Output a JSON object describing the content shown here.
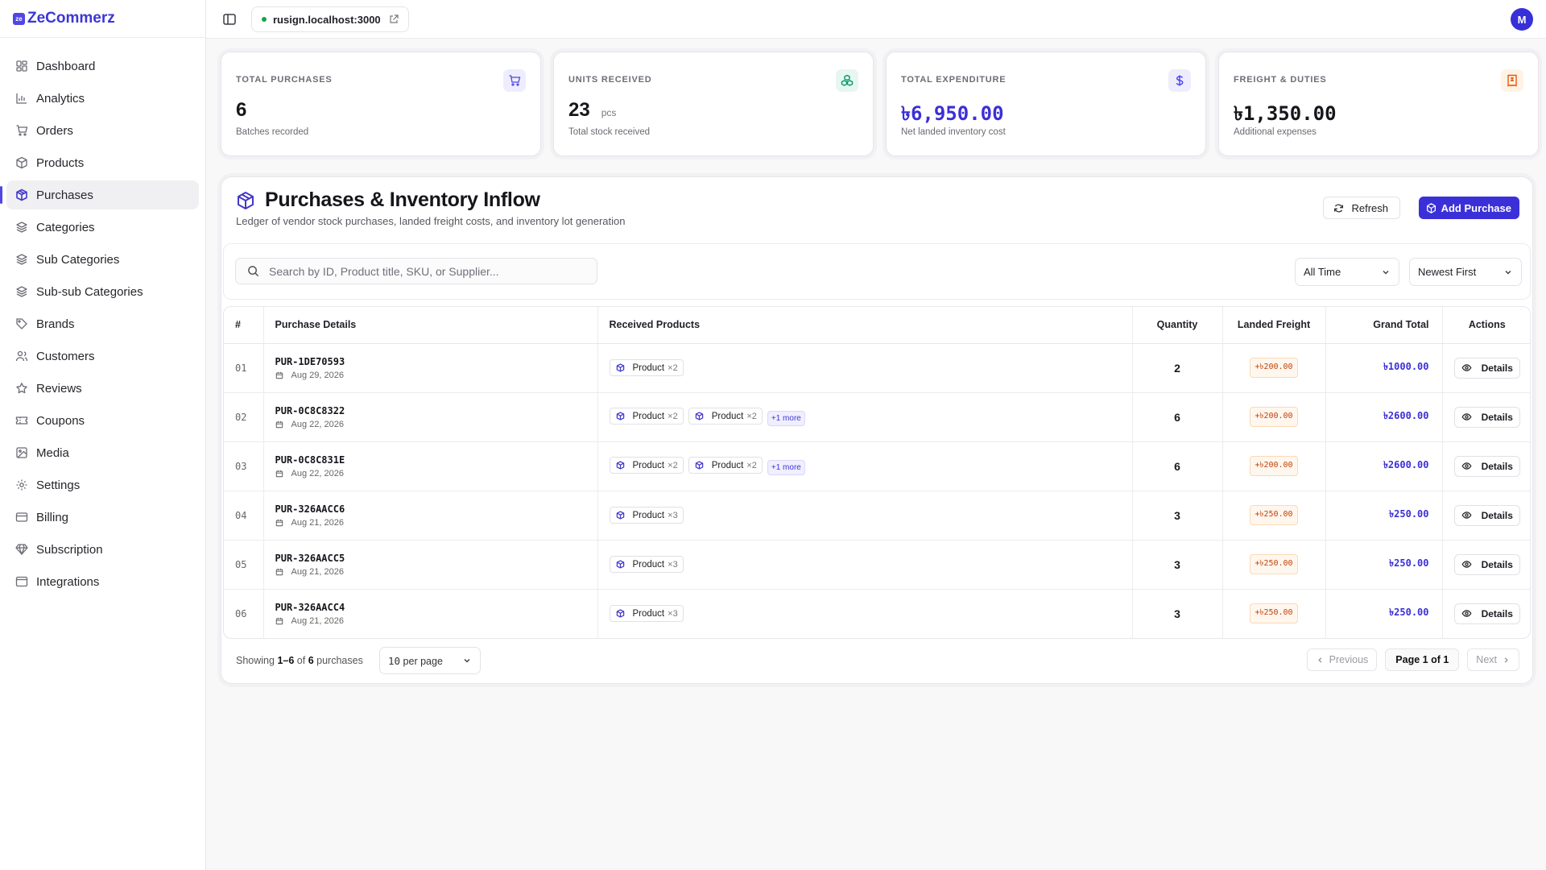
{
  "app": {
    "brand": "ZeCommerz",
    "logo_text": "ze"
  },
  "topbar": {
    "url": "rusign.localhost:3000",
    "avatar_initial": "M"
  },
  "sidebar": {
    "items": [
      {
        "label": "Dashboard",
        "icon": "dashboard-icon"
      },
      {
        "label": "Analytics",
        "icon": "analytics-icon"
      },
      {
        "label": "Orders",
        "icon": "cart-icon"
      },
      {
        "label": "Products",
        "icon": "box-icon"
      },
      {
        "label": "Purchases",
        "icon": "purchase-icon",
        "active": true
      },
      {
        "label": "Categories",
        "icon": "layers-icon"
      },
      {
        "label": "Sub Categories",
        "icon": "layers-icon"
      },
      {
        "label": "Sub-sub Categories",
        "icon": "layers-icon"
      },
      {
        "label": "Brands",
        "icon": "tag-icon"
      },
      {
        "label": "Customers",
        "icon": "users-icon"
      },
      {
        "label": "Reviews",
        "icon": "star-icon"
      },
      {
        "label": "Coupons",
        "icon": "ticket-icon"
      },
      {
        "label": "Media",
        "icon": "image-icon"
      },
      {
        "label": "Settings",
        "icon": "gear-icon"
      },
      {
        "label": "Billing",
        "icon": "card-icon"
      },
      {
        "label": "Subscription",
        "icon": "gem-icon"
      },
      {
        "label": "Integrations",
        "icon": "window-icon"
      }
    ]
  },
  "stats": [
    {
      "title": "TOTAL PURCHASES",
      "value": "6",
      "unit": "",
      "sub": "Batches recorded",
      "icon": "cart-icon",
      "accent": "#4f46e5",
      "accent_bg": "#eeedfd"
    },
    {
      "title": "UNITS RECEIVED",
      "value": "23",
      "unit": "pcs",
      "sub": "Total stock received",
      "icon": "boxes-icon",
      "accent": "#059669",
      "accent_bg": "#e7f7f0"
    },
    {
      "title": "TOTAL EXPENDITURE",
      "value": "৳6,950.00",
      "unit": "",
      "sub": "Net landed inventory cost",
      "icon": "dollar-icon",
      "accent": "#4f46e5",
      "accent_bg": "#eeedfd"
    },
    {
      "title": "FREIGHT & DUTIES",
      "value": "৳1,350.00",
      "unit": "",
      "sub": "Additional expenses",
      "icon": "receipt-icon",
      "accent": "#ea580c",
      "accent_bg": "#fff3e6"
    }
  ],
  "panel": {
    "title": "Purchases & Inventory Inflow",
    "subtitle": "Ledger of vendor stock purchases, landed freight costs, and inventory lot generation",
    "refresh_label": "Refresh",
    "add_label": "Add Purchase"
  },
  "filters": {
    "search_placeholder": "Search by ID, Product title, SKU, or Supplier...",
    "time_range": "All Time",
    "sort": "Newest First"
  },
  "table": {
    "headers": [
      "#",
      "Purchase Details",
      "Received Products",
      "Quantity",
      "Landed Freight",
      "Grand Total",
      "Actions"
    ],
    "rows": [
      {
        "num": "01",
        "id": "PUR-1DE70593",
        "date": "Aug 29, 2026",
        "products": [
          {
            "name": "Product",
            "qty": "×2"
          }
        ],
        "more": "",
        "quantity": "2",
        "freight": "+৳200.00",
        "total": "৳1000.00",
        "action": "Details"
      },
      {
        "num": "02",
        "id": "PUR-0C8C8322",
        "date": "Aug 22, 2026",
        "products": [
          {
            "name": "Product",
            "qty": "×2"
          },
          {
            "name": "Product",
            "qty": "×2"
          }
        ],
        "more": "+1 more",
        "quantity": "6",
        "freight": "+৳200.00",
        "total": "৳2600.00",
        "action": "Details"
      },
      {
        "num": "03",
        "id": "PUR-0C8C831E",
        "date": "Aug 22, 2026",
        "products": [
          {
            "name": "Product",
            "qty": "×2"
          },
          {
            "name": "Product",
            "qty": "×2"
          }
        ],
        "more": "+1 more",
        "quantity": "6",
        "freight": "+৳200.00",
        "total": "৳2600.00",
        "action": "Details"
      },
      {
        "num": "04",
        "id": "PUR-326AACC6",
        "date": "Aug 21, 2026",
        "products": [
          {
            "name": "Product",
            "qty": "×3"
          }
        ],
        "more": "",
        "quantity": "3",
        "freight": "+৳250.00",
        "total": "৳250.00",
        "action": "Details"
      },
      {
        "num": "05",
        "id": "PUR-326AACC5",
        "date": "Aug 21, 2026",
        "products": [
          {
            "name": "Product",
            "qty": "×3"
          }
        ],
        "more": "",
        "quantity": "3",
        "freight": "+৳250.00",
        "total": "৳250.00",
        "action": "Details"
      },
      {
        "num": "06",
        "id": "PUR-326AACC4",
        "date": "Aug 21, 2026",
        "products": [
          {
            "name": "Product",
            "qty": "×3"
          }
        ],
        "more": "",
        "quantity": "3",
        "freight": "+৳250.00",
        "total": "৳250.00",
        "action": "Details"
      }
    ]
  },
  "pagination": {
    "showing_prefix": "Showing",
    "range": "1–6",
    "of_text": "of",
    "total": "6",
    "suffix": "purchases",
    "per_page_num": "10",
    "per_page_text": "per page",
    "previous": "Previous",
    "page_label": "Page 1 of 1",
    "next": "Next"
  }
}
